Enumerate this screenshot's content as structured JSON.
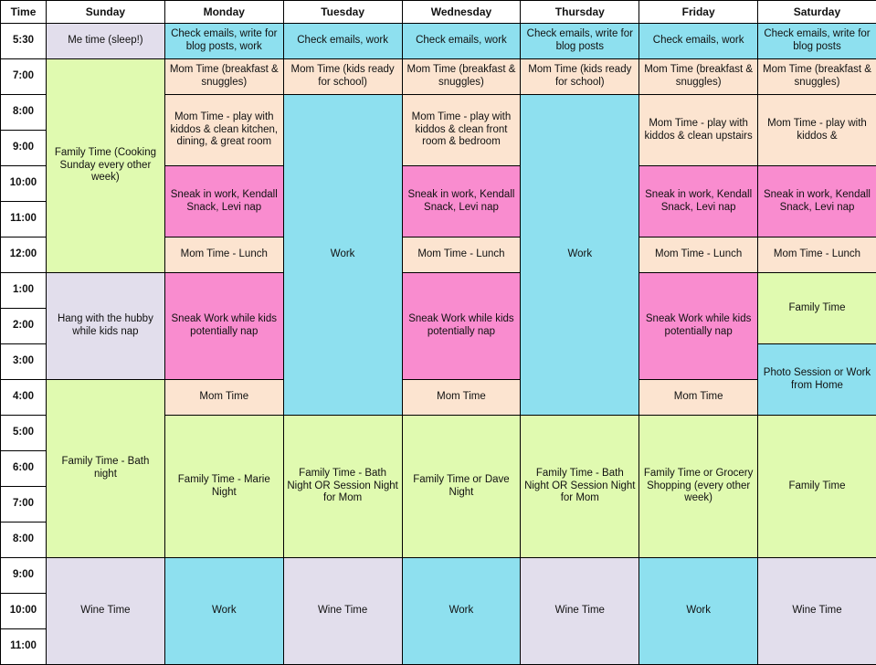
{
  "table": {
    "headers": [
      "Time",
      "Sunday",
      "Monday",
      "Tuesday",
      "Wednesday",
      "Thursday",
      "Friday",
      "Saturday"
    ],
    "times": [
      "5:30",
      "7:00",
      "8:00",
      "9:00",
      "10:00",
      "11:00",
      "12:00",
      "1:00",
      "2:00",
      "3:00",
      "4:00",
      "5:00",
      "6:00",
      "7:00",
      "8:00",
      "9:00",
      "10:00",
      "11:00"
    ],
    "colors": {
      "work_cyan": "#8EE0EF",
      "mom_peach": "#FCE4D0",
      "sneak_pink": "#F98CCF",
      "family_green": "#E0FAB0",
      "rest_lavender": "#E2DEEC",
      "border": "#000000",
      "header_bg": "#FFFFFF",
      "text": "#111111"
    },
    "rows": [
      {
        "time": "5:30",
        "cells": [
          {
            "day": "Sunday",
            "text": "Me time (sleep!)",
            "color": "lavender",
            "rowspan": 1
          },
          {
            "day": "Monday",
            "text": "Check emails, write for blog posts, work",
            "color": "cyan",
            "rowspan": 1
          },
          {
            "day": "Tuesday",
            "text": "Check emails, work",
            "color": "cyan",
            "rowspan": 1
          },
          {
            "day": "Wednesday",
            "text": "Check emails, work",
            "color": "cyan",
            "rowspan": 1
          },
          {
            "day": "Thursday",
            "text": "Check emails, write for blog posts",
            "color": "cyan",
            "rowspan": 1
          },
          {
            "day": "Friday",
            "text": "Check emails, work",
            "color": "cyan",
            "rowspan": 1
          },
          {
            "day": "Saturday",
            "text": "Check emails, write for blog posts",
            "color": "cyan",
            "rowspan": 1
          }
        ]
      },
      {
        "time": "7:00",
        "cells": [
          {
            "day": "Sunday",
            "text": "Family Time (Cooking Sunday every other week)",
            "color": "green",
            "rowspan": 6
          },
          {
            "day": "Monday",
            "text": "Mom Time (breakfast & snuggles)",
            "color": "peach",
            "rowspan": 1
          },
          {
            "day": "Tuesday",
            "text": "Mom Time (kids ready for school)",
            "color": "peach",
            "rowspan": 1
          },
          {
            "day": "Wednesday",
            "text": "Mom Time (breakfast & snuggles)",
            "color": "peach",
            "rowspan": 1
          },
          {
            "day": "Thursday",
            "text": "Mom Time (kids ready for school)",
            "color": "peach",
            "rowspan": 1
          },
          {
            "day": "Friday",
            "text": "Mom Time (breakfast & snuggles)",
            "color": "peach",
            "rowspan": 1
          },
          {
            "day": "Saturday",
            "text": "Mom Time (breakfast & snuggles)",
            "color": "peach",
            "rowspan": 1
          }
        ]
      },
      {
        "time": "8:00",
        "cells": [
          {
            "day": "Monday",
            "text": "Mom Time - play with kiddos & clean kitchen, dining, & great room",
            "color": "peach",
            "rowspan": 2
          },
          {
            "day": "Tuesday",
            "text": "Work",
            "color": "cyan",
            "rowspan": 9
          },
          {
            "day": "Wednesday",
            "text": "Mom Time - play with kiddos & clean front room & bedroom",
            "color": "peach",
            "rowspan": 2
          },
          {
            "day": "Thursday",
            "text": "Work",
            "color": "cyan",
            "rowspan": 9
          },
          {
            "day": "Friday",
            "text": "Mom Time - play with kiddos & clean upstairs",
            "color": "peach",
            "rowspan": 2
          },
          {
            "day": "Saturday",
            "text": "Mom Time - play with kiddos &",
            "color": "peach",
            "rowspan": 2
          }
        ]
      },
      {
        "time": "9:00",
        "cells": []
      },
      {
        "time": "10:00",
        "cells": [
          {
            "day": "Monday",
            "text": "Sneak in work, Kendall Snack, Levi nap",
            "color": "pink",
            "rowspan": 2
          },
          {
            "day": "Wednesday",
            "text": "Sneak in work, Kendall Snack, Levi nap",
            "color": "pink",
            "rowspan": 2
          },
          {
            "day": "Friday",
            "text": "Sneak in work, Kendall Snack, Levi nap",
            "color": "pink",
            "rowspan": 2
          },
          {
            "day": "Saturday",
            "text": "Sneak in work, Kendall Snack, Levi nap",
            "color": "pink",
            "rowspan": 2
          }
        ]
      },
      {
        "time": "11:00",
        "cells": []
      },
      {
        "time": "12:00",
        "cells": [
          {
            "day": "Monday",
            "text": "Mom Time - Lunch",
            "color": "peach",
            "rowspan": 1
          },
          {
            "day": "Wednesday",
            "text": "Mom Time - Lunch",
            "color": "peach",
            "rowspan": 1
          },
          {
            "day": "Friday",
            "text": "Mom Time - Lunch",
            "color": "peach",
            "rowspan": 1
          },
          {
            "day": "Saturday",
            "text": "Mom Time - Lunch",
            "color": "peach",
            "rowspan": 1
          }
        ]
      },
      {
        "time": "1:00",
        "cells": [
          {
            "day": "Sunday",
            "text": "Hang with the hubby while kids nap",
            "color": "lavender",
            "rowspan": 3
          },
          {
            "day": "Monday",
            "text": "Sneak Work while kids potentially nap",
            "color": "pink",
            "rowspan": 3
          },
          {
            "day": "Wednesday",
            "text": "Sneak Work while kids potentially nap",
            "color": "pink",
            "rowspan": 3
          },
          {
            "day": "Friday",
            "text": "Sneak Work while kids potentially nap",
            "color": "pink",
            "rowspan": 3
          },
          {
            "day": "Saturday",
            "text": "Family Time",
            "color": "green",
            "rowspan": 2
          }
        ]
      },
      {
        "time": "2:00",
        "cells": []
      },
      {
        "time": "3:00",
        "cells": [
          {
            "day": "Saturday",
            "text": "Photo Session or Work from Home",
            "color": "cyan",
            "rowspan": 2
          }
        ]
      },
      {
        "time": "4:00",
        "cells": [
          {
            "day": "Sunday",
            "text": "Family Time - Bath night",
            "color": "green",
            "rowspan": 5
          },
          {
            "day": "Monday",
            "text": "Mom Time",
            "color": "peach",
            "rowspan": 1
          },
          {
            "day": "Wednesday",
            "text": "Mom Time",
            "color": "peach",
            "rowspan": 1
          },
          {
            "day": "Friday",
            "text": "Mom Time",
            "color": "peach",
            "rowspan": 1
          }
        ]
      },
      {
        "time": "5:00",
        "cells": [
          {
            "day": "Monday",
            "text": "Family Time - Marie Night",
            "color": "green",
            "rowspan": 4
          },
          {
            "day": "Tuesday",
            "text": "Family Time - Bath Night OR Session Night for Mom",
            "color": "green",
            "rowspan": 4
          },
          {
            "day": "Wednesday",
            "text": "Family Time or Dave Night",
            "color": "green",
            "rowspan": 4
          },
          {
            "day": "Thursday",
            "text": "Family Time - Bath Night OR Session Night for Mom",
            "color": "green",
            "rowspan": 4
          },
          {
            "day": "Friday",
            "text": "Family Time or Grocery Shopping (every other week)",
            "color": "green",
            "rowspan": 4
          },
          {
            "day": "Saturday",
            "text": "Family Time",
            "color": "green",
            "rowspan": 4
          }
        ]
      },
      {
        "time": "6:00",
        "cells": []
      },
      {
        "time": "7:00",
        "cells": []
      },
      {
        "time": "8:00",
        "cells": []
      },
      {
        "time": "9:00",
        "cells": [
          {
            "day": "Sunday",
            "text": "Wine Time",
            "color": "lavender",
            "rowspan": 3
          },
          {
            "day": "Monday",
            "text": "Work",
            "color": "cyan",
            "rowspan": 3
          },
          {
            "day": "Tuesday",
            "text": "Wine Time",
            "color": "lavender",
            "rowspan": 3
          },
          {
            "day": "Wednesday",
            "text": "Work",
            "color": "cyan",
            "rowspan": 3
          },
          {
            "day": "Thursday",
            "text": "Wine Time",
            "color": "lavender",
            "rowspan": 3
          },
          {
            "day": "Friday",
            "text": "Work",
            "color": "cyan",
            "rowspan": 3
          },
          {
            "day": "Saturday",
            "text": "Wine Time",
            "color": "lavender",
            "rowspan": 3
          }
        ]
      },
      {
        "time": "10:00",
        "cells": []
      },
      {
        "time": "11:00",
        "cells": []
      }
    ]
  }
}
